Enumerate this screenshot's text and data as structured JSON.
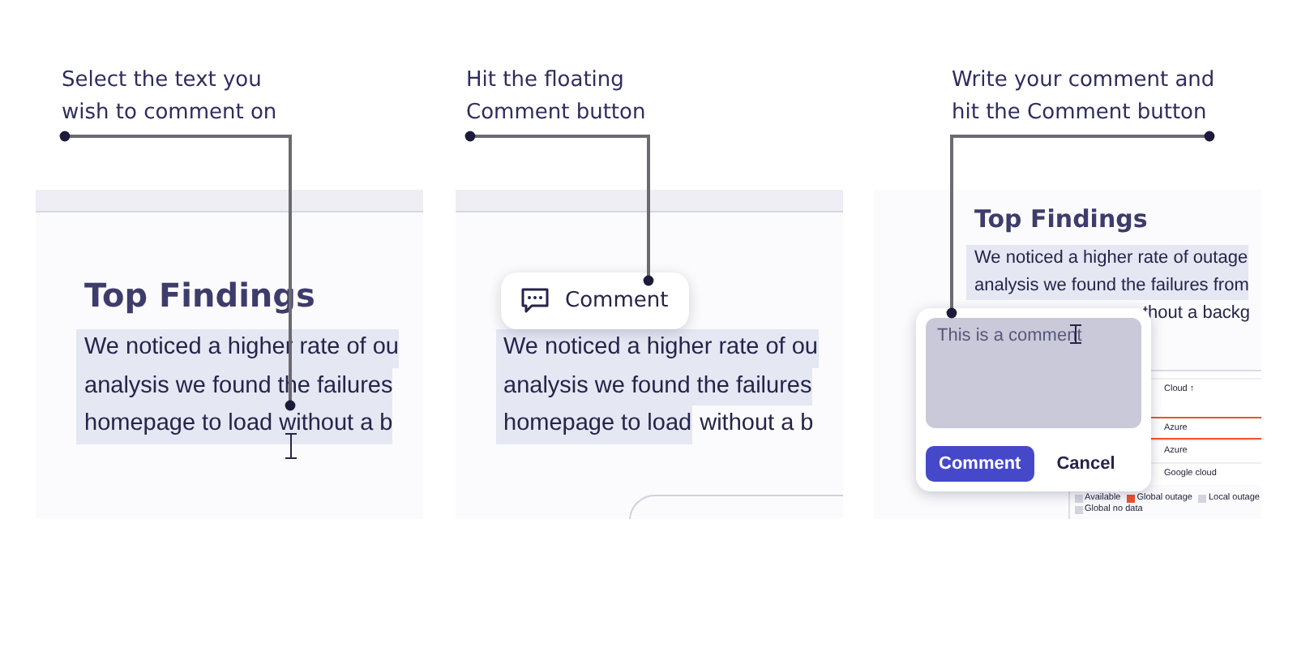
{
  "panels": [
    {
      "kind": "select",
      "caption": [
        "Select the text you",
        "wish to comment on"
      ],
      "heading": "Top Findings",
      "lines": [
        {
          "segments": [
            {
              "text": "We noticed a higher rate of ou",
              "selected": true
            }
          ]
        },
        {
          "segments": [
            {
              "text": "analysis we found the failures",
              "selected": true
            }
          ]
        },
        {
          "segments": [
            {
              "text": "homepage to load without a b",
              "selected": true
            }
          ]
        }
      ]
    },
    {
      "kind": "float",
      "caption": [
        "Hit the floating",
        "Comment button"
      ],
      "float_button": "Comment",
      "lines": [
        {
          "segments": [
            {
              "text": "We noticed a higher rate of ou",
              "selected": true
            }
          ]
        },
        {
          "segments": [
            {
              "text": "analysis we found the failures",
              "selected": true
            }
          ]
        },
        {
          "segments": [
            {
              "text": "homepage to load",
              "selected": true
            },
            {
              "text": "without a b",
              "selected": false
            }
          ]
        }
      ]
    },
    {
      "kind": "write",
      "caption": [
        "Write your comment and",
        "hit the Comment button"
      ],
      "heading": "Top Findings",
      "lines": [
        {
          "segments": [
            {
              "text": "We noticed a higher rate of outage",
              "selected": true
            }
          ]
        },
        {
          "segments": [
            {
              "text": "analysis we found the failures from",
              "selected": true
            }
          ]
        },
        {
          "segments": [
            {
              "text": "thout a backg",
              "selected": false
            }
          ]
        }
      ],
      "table": {
        "rows": [
          {
            "text": "Cloud ↑",
            "alert": false
          },
          {
            "text": "Azure",
            "alert": true
          },
          {
            "text": "Azure",
            "alert": false
          },
          {
            "text": "Google cloud",
            "alert": false
          }
        ],
        "legend": [
          {
            "label": "Available",
            "color": "#d4d4de"
          },
          {
            "label": "Global outage",
            "color": "#f0522a"
          },
          {
            "label": "Local outage",
            "color": "#d4d4de"
          },
          {
            "label": "Global no data",
            "color": "#d4d4de"
          }
        ]
      },
      "popup": {
        "value": "This is a comment",
        "buttons": [
          {
            "label": "Comment",
            "primary": true
          },
          {
            "label": "Cancel",
            "primary": false
          }
        ]
      }
    }
  ]
}
